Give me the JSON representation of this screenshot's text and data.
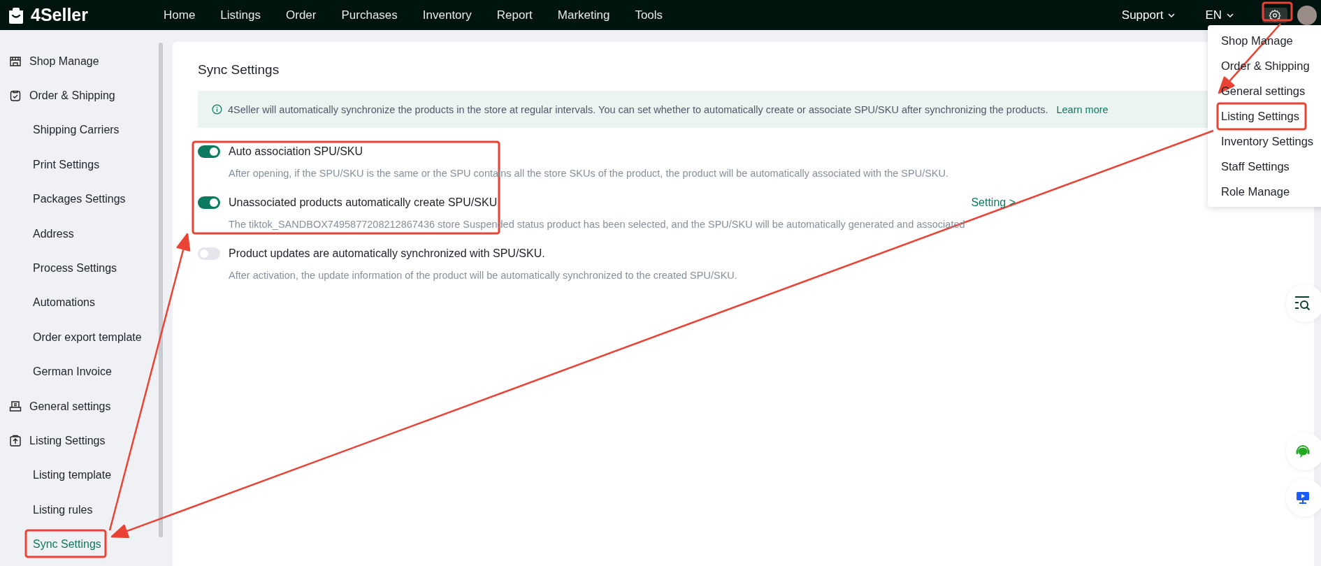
{
  "topbar": {
    "logo": "4Seller",
    "nav": [
      "Home",
      "Listings",
      "Order",
      "Purchases",
      "Inventory",
      "Report",
      "Marketing",
      "Tools"
    ],
    "support": "Support",
    "language": "EN"
  },
  "sidebar": {
    "groups": [
      {
        "label": "Shop Manage",
        "selected": false
      },
      {
        "label": "Order & Shipping",
        "selected": false,
        "children": [
          {
            "label": "Shipping Carriers",
            "selected": false
          },
          {
            "label": "Print Settings",
            "selected": false
          },
          {
            "label": "Packages Settings",
            "selected": false
          },
          {
            "label": "Address",
            "selected": false
          },
          {
            "label": "Process Settings",
            "selected": false
          },
          {
            "label": "Automations",
            "selected": false
          },
          {
            "label": "Order export template",
            "selected": false
          },
          {
            "label": "German Invoice",
            "selected": false
          }
        ]
      },
      {
        "label": "General settings",
        "selected": false
      },
      {
        "label": "Listing Settings",
        "selected": false,
        "children": [
          {
            "label": "Listing template",
            "selected": false
          },
          {
            "label": "Listing rules",
            "selected": false
          },
          {
            "label": "Sync Settings",
            "selected": true
          }
        ]
      }
    ]
  },
  "content": {
    "title": "Sync Settings",
    "info": {
      "text": "4Seller will automatically synchronize the products in the store at regular intervals. You can set whether to automatically create or associate SPU/SKU after synchronizing the products.",
      "link": "Learn more"
    },
    "settings": [
      {
        "label": "Auto association SPU/SKU",
        "on": true,
        "description": "After opening, if the SPU/SKU is the same or the SPU contains all the store SKUs of the product, the product will be automatically associated with the SPU/SKU."
      },
      {
        "label": "Unassociated products automatically create SPU/SKU",
        "on": true,
        "description": "The tiktok_SANDBOX7495877208212867436 store Suspended status product has been selected, and the SPU/SKU will be automatically generated and associated",
        "action": "Setting >"
      },
      {
        "label": "Product updates are automatically synchronized with SPU/SKU.",
        "on": false,
        "description": "After activation, the update information of the product will be automatically synchronized to the created SPU/SKU."
      }
    ]
  },
  "settings_menu": {
    "items": [
      "Shop Manage",
      "Order & Shipping",
      "General settings",
      "Listing Settings",
      "Inventory Settings",
      "Staff Settings",
      "Role Manage"
    ]
  }
}
